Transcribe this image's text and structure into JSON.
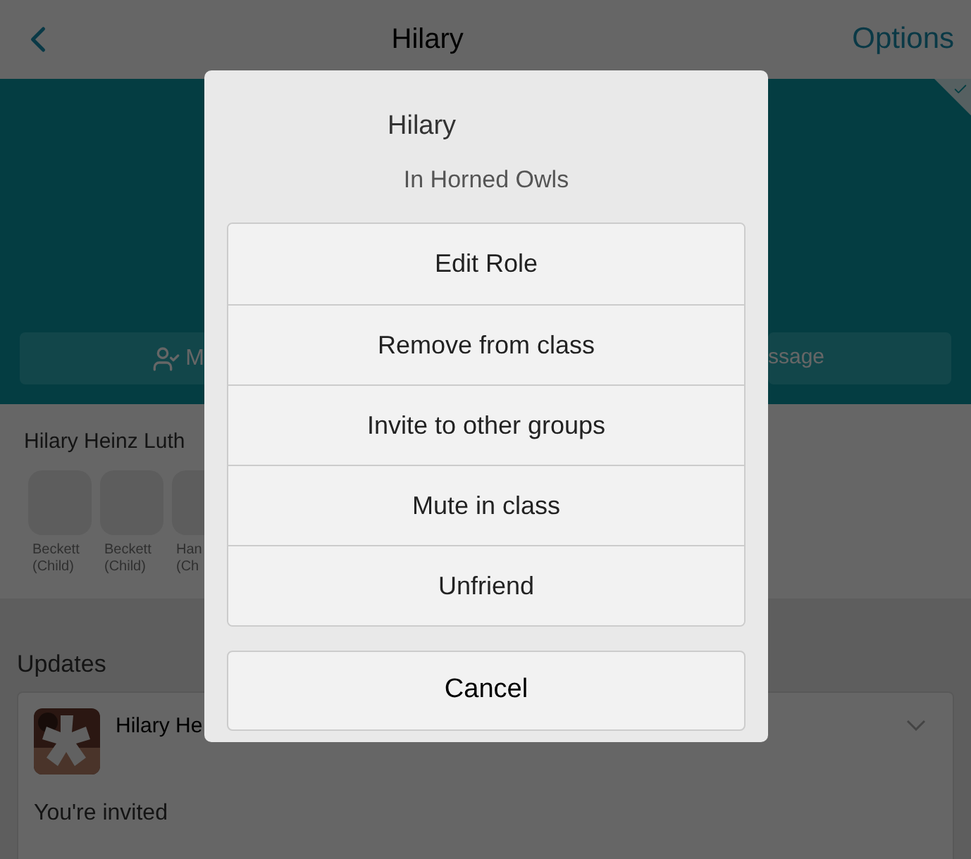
{
  "nav": {
    "title": "Hilary",
    "options": "Options"
  },
  "profile_actions": [
    {
      "label": "M"
    },
    {
      "label": "ssage"
    }
  ],
  "family": {
    "title": "Hilary Heinz Luth",
    "members": [
      {
        "name": "Beckett",
        "role": "(Child)"
      },
      {
        "name": "Beckett",
        "role": "(Child)"
      },
      {
        "name": "Han",
        "role": "(Ch"
      }
    ]
  },
  "updates": {
    "title": "Updates",
    "post": {
      "author": "Hilary He",
      "text": "You're invited"
    }
  },
  "dialog": {
    "title": "Hilary",
    "subtitle": "In Horned Owls",
    "actions": [
      "Edit Role",
      "Remove from class",
      "Invite to other groups",
      "Mute in class",
      "Unfriend"
    ],
    "cancel": "Cancel"
  }
}
